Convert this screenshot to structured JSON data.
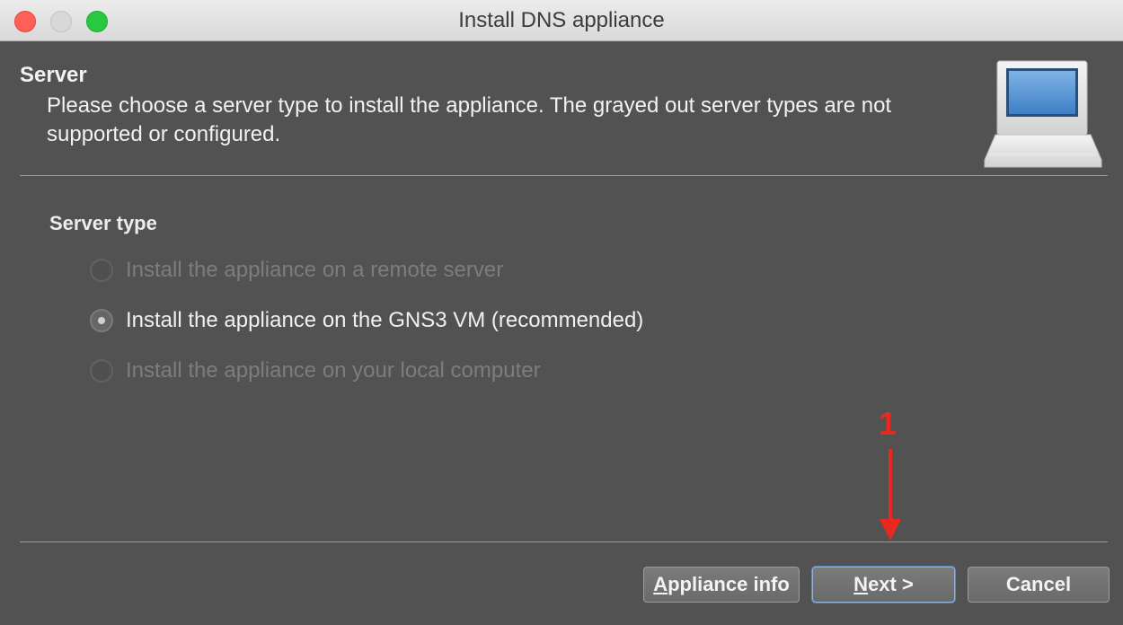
{
  "window": {
    "title": "Install DNS appliance"
  },
  "header": {
    "title": "Server",
    "subtitle": "Please choose a server type to install the appliance. The grayed out server types are not supported or configured.",
    "icon": "computer-icon"
  },
  "server_type": {
    "label": "Server type",
    "options": [
      {
        "label": "Install the appliance on a remote server",
        "enabled": false,
        "selected": false
      },
      {
        "label": "Install the appliance on the GNS3 VM (recommended)",
        "enabled": true,
        "selected": true
      },
      {
        "label": "Install the appliance on your local computer",
        "enabled": false,
        "selected": false
      }
    ]
  },
  "annotation": {
    "number": "1",
    "color": "#e8291f"
  },
  "buttons": {
    "info": {
      "mnemonic": "A",
      "rest": "ppliance info"
    },
    "next": {
      "mnemonic": "N",
      "rest": "ext >"
    },
    "cancel": {
      "label": "Cancel"
    }
  },
  "colors": {
    "close": "#fe5f57",
    "minimize": "#d8d8d8",
    "maximize": "#28c840",
    "background": "#525252"
  }
}
